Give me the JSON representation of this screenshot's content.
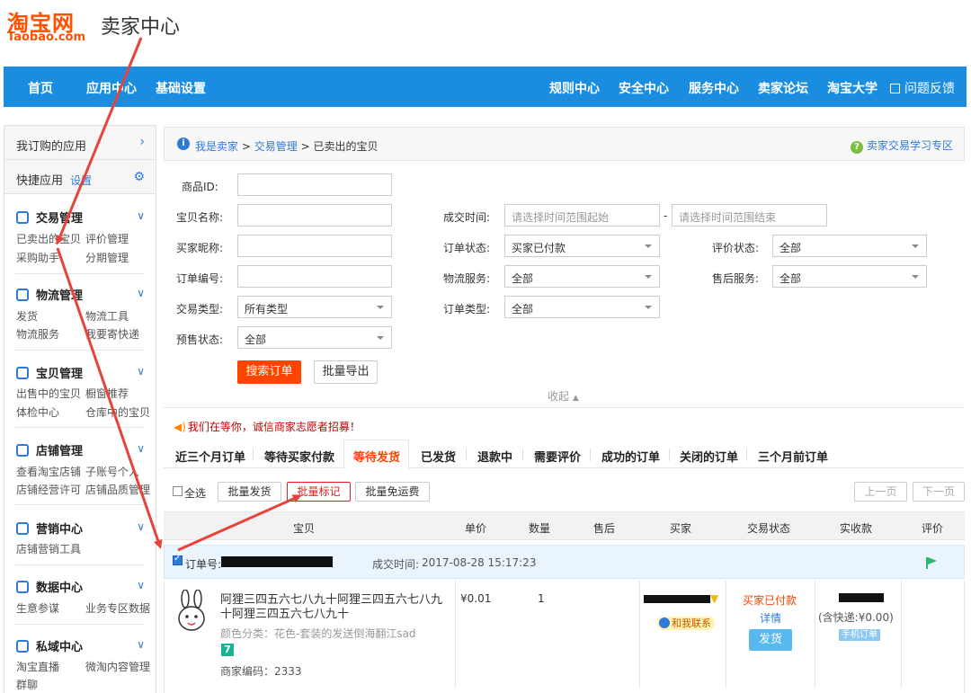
{
  "header": {
    "logo_top": "淘宝网",
    "logo_sub": "Taobao.com",
    "title": "卖家中心"
  },
  "topnav": {
    "left": [
      "首页",
      "应用中心",
      "基础设置"
    ],
    "right": [
      "规则中心",
      "安全中心",
      "服务中心",
      "卖家论坛",
      "淘宝大学"
    ],
    "feedback": "问题反馈"
  },
  "sidebar": {
    "subscribed": "我订购的应用",
    "quick": "快捷应用",
    "quick_setting": "设置",
    "sections": [
      {
        "title": "交易管理",
        "items": [
          "已卖出的宝贝",
          "评价管理",
          "采购助手",
          "分期管理"
        ]
      },
      {
        "title": "物流管理",
        "items": [
          "发货",
          "物流工具",
          "物流服务",
          "我要寄快递"
        ]
      },
      {
        "title": "宝贝管理",
        "items": [
          "出售中的宝贝",
          "橱窗推荐",
          "体检中心",
          "仓库中的宝贝"
        ]
      },
      {
        "title": "店铺管理",
        "items": [
          "查看淘宝店铺",
          "子账号个人",
          "店铺经营许可",
          "店铺品质管理"
        ]
      },
      {
        "title": "营销中心",
        "items": [
          "店铺营销工具"
        ]
      },
      {
        "title": "数据中心",
        "items": [
          "生意参谋",
          "业务专区数据"
        ]
      },
      {
        "title": "私域中心",
        "items": [
          "淘宝直播",
          "微淘内容管理",
          "群聊"
        ]
      }
    ]
  },
  "breadcrumb": {
    "items": [
      "我是卖家",
      "交易管理",
      "已卖出的宝贝"
    ],
    "separator": ">",
    "help": "卖家交易学习专区"
  },
  "form": {
    "item_id_label": "商品ID:",
    "item_name_label": "宝贝名称:",
    "buyer_nick_label": "买家昵称:",
    "order_no_label": "订单编号:",
    "trade_type_label": "交易类型:",
    "trade_type_value": "所有类型",
    "presale_label": "预售状态:",
    "presale_value": "全部",
    "deal_time_label": "成交时间:",
    "deal_time_start_placeholder": "请选择时间范围起始",
    "deal_time_dash": "-",
    "deal_time_end_placeholder": "请选择时间范围结束",
    "order_status_label": "订单状态:",
    "order_status_value": "买家已付款",
    "logistics_label": "物流服务:",
    "logistics_value": "全部",
    "order_type_label": "订单类型:",
    "order_type_value": "全部",
    "rating_label": "评价状态:",
    "rating_value": "全部",
    "after_sale_label": "售后服务:",
    "after_sale_value": "全部",
    "search_button": "搜索订单",
    "export_button": "批量导出",
    "collapse": "收起"
  },
  "notice": "我们在等你，诚信商家志愿者招募！",
  "tabs": [
    "近三个月订单",
    "等待买家付款",
    "等待发货",
    "已发货",
    "退款中",
    "需要评价",
    "成功的订单",
    "关闭的订单",
    "三个月前订单"
  ],
  "active_tab": "等待发货",
  "actions": {
    "select_all": "全选",
    "batch_ship": "批量发货",
    "batch_mark": "批量标记",
    "batch_free_shipping": "批量免运费",
    "prev_page": "上一页",
    "next_page": "下一页"
  },
  "table_headers": [
    "宝贝",
    "单价",
    "数量",
    "售后",
    "买家",
    "交易状态",
    "实收款",
    "评价"
  ],
  "order": {
    "order_no_label": "订单号:",
    "deal_time_label": "成交时间:",
    "deal_time": "2017-08-28 15:17:23",
    "item_title": "阿狸三四五六七八九十阿狸三四五六七八九十阿狸三四五六七八九十",
    "item_attr": "颜色分类：花色-套装的发送倒海翻江sad",
    "seven_badge": "7",
    "merchant_code": "商家编码：2333",
    "price": "¥0.01",
    "quantity": "1",
    "contact": "和我联系",
    "status": "买家已付款",
    "detail": "详情",
    "ship_button": "发货",
    "shipping_note": "(含快递:¥0.00)",
    "mobile_order": "手机订单"
  }
}
